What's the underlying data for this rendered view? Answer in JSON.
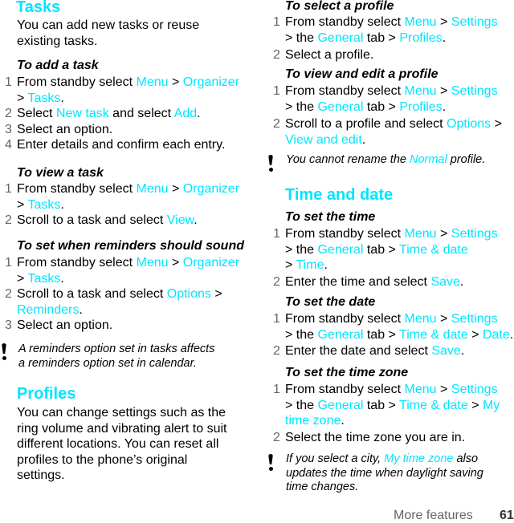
{
  "accent_color": "#00e5ff",
  "left": {
    "tasks": {
      "heading": "Tasks",
      "intro": [
        "You can add new tasks or reuse",
        "existing tasks."
      ],
      "add": {
        "title": "To add a task",
        "steps": [
          {
            "num": "1",
            "l1a": "From standby select ",
            "menu": "Menu",
            "gt1": " > ",
            "organizer": "Organizer",
            "l2a": "> ",
            "tasks": "Tasks",
            "end": "."
          },
          {
            "num": "2",
            "a": "Select ",
            "newtask": "New task",
            "b": " and select ",
            "add": "Add",
            "end": "."
          },
          {
            "num": "3",
            "text": "Select an option."
          },
          {
            "num": "4",
            "text": "Enter details and confirm each entry."
          }
        ]
      },
      "view": {
        "title": "To view a task",
        "steps": [
          {
            "num": "1",
            "l1a": "From standby select ",
            "menu": "Menu",
            "gt1": " > ",
            "organizer": "Organizer",
            "l2a": "> ",
            "tasks": "Tasks",
            "end": "."
          },
          {
            "num": "2",
            "a": "Scroll to a task and select ",
            "view": "View",
            "end": "."
          }
        ]
      },
      "reminders": {
        "title": "To set when reminders should sound",
        "steps": [
          {
            "num": "1",
            "l1a": "From standby select ",
            "menu": "Menu",
            "gt1": " > ",
            "organizer": "Organizer",
            "l2a": "> ",
            "tasks": "Tasks",
            "end": "."
          },
          {
            "num": "2",
            "a": "Scroll to a task and select ",
            "options": "Options",
            "gt": " >",
            "reminders": "Reminders",
            "end": "."
          },
          {
            "num": "3",
            "text": "Select an option."
          }
        ]
      },
      "note": [
        "A reminders option set in tasks affects",
        "a reminders option set in calendar."
      ]
    },
    "profiles": {
      "heading": "Profiles",
      "intro": [
        "You can change settings such as the",
        "ring volume and vibrating alert to suit",
        "different locations. You can reset all",
        "profiles to the phone’s original",
        "settings."
      ]
    }
  },
  "right": {
    "select_profile": {
      "title": "To select a profile",
      "steps": [
        {
          "num": "1",
          "a": "From standby select ",
          "menu": "Menu",
          "gt": " > ",
          "settings": "Settings",
          "b": "> the ",
          "general": "General",
          "c": " tab > ",
          "profiles": "Profiles",
          "end": "."
        },
        {
          "num": "2",
          "text": "Select a profile."
        }
      ]
    },
    "edit_profile": {
      "title": "To view and edit a profile",
      "steps": [
        {
          "num": "1",
          "a": "From standby select ",
          "menu": "Menu",
          "gt": " > ",
          "settings": "Settings",
          "b": "> the ",
          "general": "General",
          "c": " tab > ",
          "profiles": "Profiles",
          "end": "."
        },
        {
          "num": "2",
          "a": "Scroll to a profile and select ",
          "options": "Options",
          "gt": " >",
          "viewedit": "View and edit",
          "end": "."
        }
      ],
      "note": {
        "a": "You cannot rename the ",
        "normal": "Normal",
        "b": " profile."
      }
    },
    "time_date": {
      "heading": "Time and date",
      "set_time": {
        "title": "To set the time",
        "steps": [
          {
            "num": "1",
            "a": "From standby select ",
            "menu": "Menu",
            "gt": " > ",
            "settings": "Settings",
            "b": "> the ",
            "general": "General",
            "c": " tab > ",
            "timedate": "Time & date",
            "d": "> ",
            "time": "Time",
            "end": "."
          },
          {
            "num": "2",
            "a": "Enter the time and select ",
            "save": "Save",
            "end": "."
          }
        ]
      },
      "set_date": {
        "title": "To set the date",
        "steps": [
          {
            "num": "1",
            "a": "From standby select ",
            "menu": "Menu",
            "gt": " > ",
            "settings": "Settings",
            "b": "> the ",
            "general": "General",
            "c": " tab > ",
            "timedate": "Time & date",
            "d": " > ",
            "date": "Date",
            "end": "."
          },
          {
            "num": "2",
            "a": "Enter the date and select ",
            "save": "Save",
            "end": "."
          }
        ]
      },
      "set_zone": {
        "title": "To set the time zone",
        "steps": [
          {
            "num": "1",
            "a": "From standby select ",
            "menu": "Menu",
            "gt": " > ",
            "settings": "Settings",
            "b": "> the ",
            "general": "General",
            "c": " tab > ",
            "timedate": "Time & date",
            "d": " > ",
            "my": "My",
            "timezone": "time zone",
            "end": "."
          },
          {
            "num": "2",
            "text": "Select the time zone you are in."
          }
        ]
      },
      "note": {
        "a": "If you select a city, ",
        "mytz": "My time zone",
        "b": " also",
        "l2": "updates the time when daylight saving",
        "l3": "time changes."
      }
    }
  },
  "footer": {
    "label": "More features",
    "page": "61"
  }
}
